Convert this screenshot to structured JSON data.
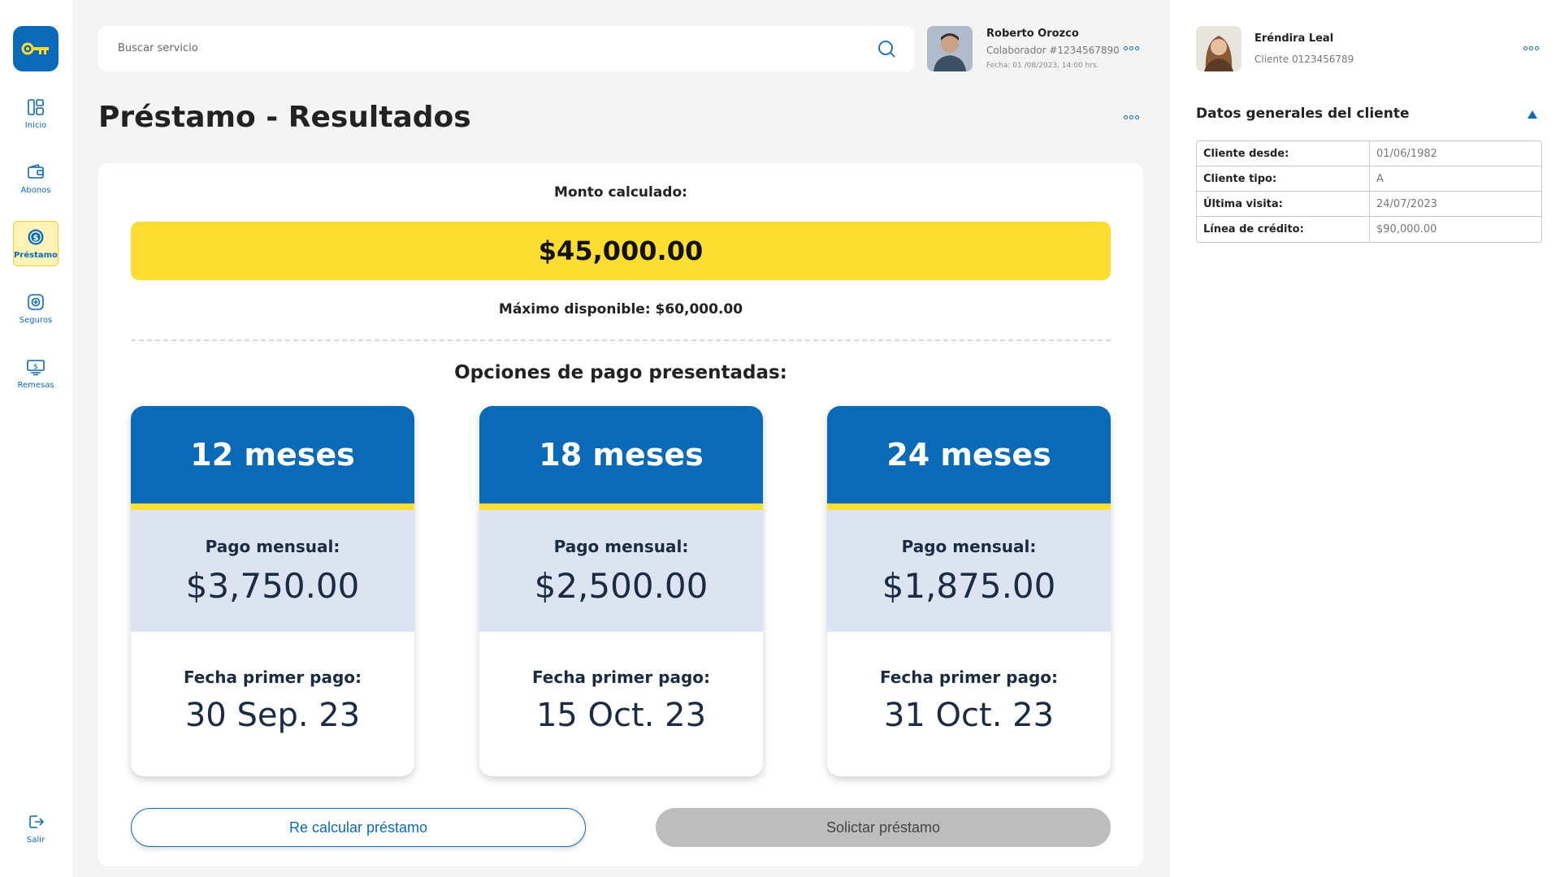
{
  "sidebar": {
    "items": [
      {
        "label": "Inicio",
        "icon": "dashboard-icon"
      },
      {
        "label": "Abonos",
        "icon": "wallet-icon"
      },
      {
        "label": "Préstamo",
        "icon": "dollar-coin-icon",
        "active": true
      },
      {
        "label": "Seguros",
        "icon": "shield-plus-icon"
      },
      {
        "label": "Remesas",
        "icon": "money-transfer-icon"
      }
    ],
    "logout_label": "Salir"
  },
  "search": {
    "placeholder": "Buscar servicio"
  },
  "collaborator": {
    "name": "Roberto Orozco",
    "id_text": "Colaborador #1234567890",
    "date_text": "Fecha: 01 /08/2023, 14:00 hrs."
  },
  "page": {
    "title": "Préstamo - Resultados"
  },
  "loan": {
    "calc_label": "Monto calculado:",
    "amount": "$45,000.00",
    "max_label": "Máximo disponible: $60,000.00",
    "options_title": "Opciones de pago presentadas:",
    "monthly_label": "Pago mensual:",
    "first_payment_label": "Fecha primer pago:",
    "options": [
      {
        "term": "12 meses",
        "monthly": "$3,750.00",
        "first_date": "30 Sep. 23"
      },
      {
        "term": "18 meses",
        "monthly": "$2,500.00",
        "first_date": "15 Oct. 23"
      },
      {
        "term": "24 meses",
        "monthly": "$1,875.00",
        "first_date": "31 Oct. 23"
      }
    ],
    "recalc_label": "Re calcular préstamo",
    "request_label": "Solictar préstamo"
  },
  "client": {
    "name": "Eréndira Leal",
    "id_text": "Cliente 0123456789",
    "section_title": "Datos generales del cliente",
    "rows": [
      {
        "key": "Cliente desde:",
        "value": "01/06/1982"
      },
      {
        "key": "Cliente tipo:",
        "value": "A"
      },
      {
        "key": "Última visita:",
        "value": "24/07/2023"
      },
      {
        "key": "Línea de crédito:",
        "value": "$90,000.00"
      }
    ]
  },
  "colors": {
    "primary": "#0b6ab8",
    "accent": "#fedd32",
    "pay_bg": "#dce4f2",
    "disabled": "#bdbdbd"
  }
}
